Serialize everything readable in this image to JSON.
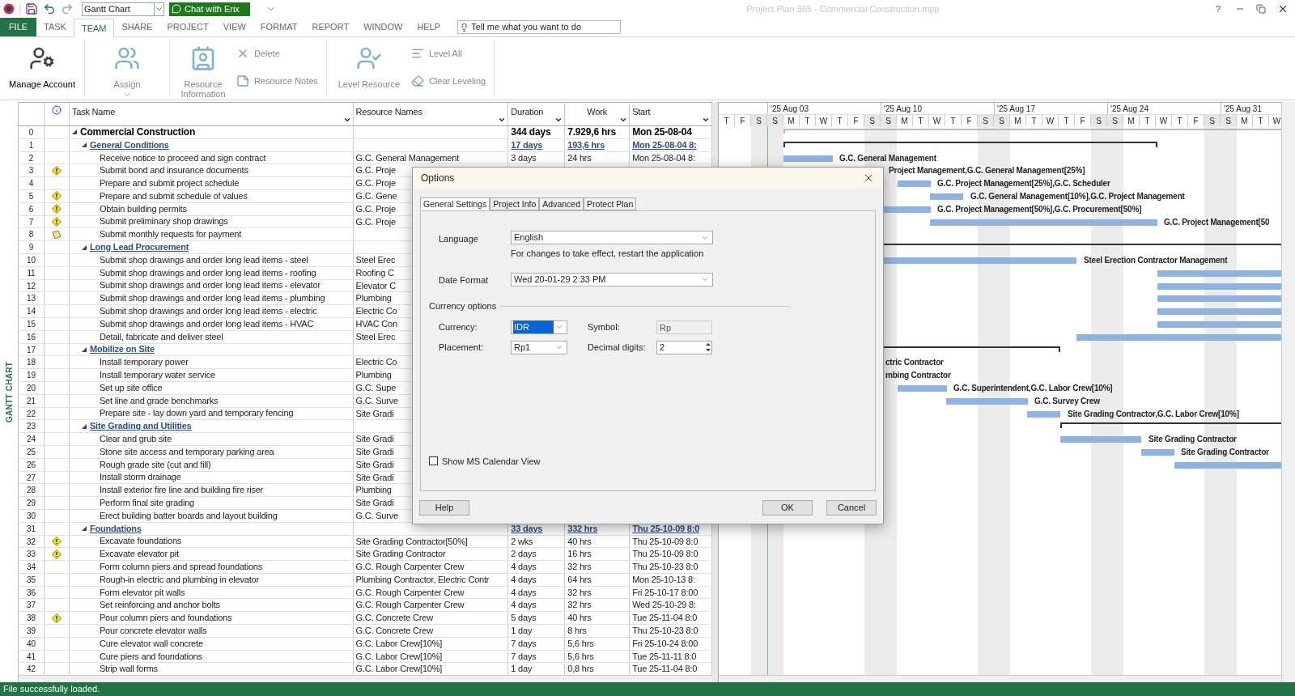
{
  "quick_access": {
    "view_selector": "Gantt Chart",
    "chat_button": "Chat with Erix"
  },
  "window": {
    "title": "Project Plan 365 - Commercial Construction.mpp",
    "help": "?"
  },
  "file_tab": "FILE",
  "ribbon_tabs": [
    {
      "label": "TASK",
      "selected": false
    },
    {
      "label": "TEAM",
      "selected": true
    },
    {
      "label": "SHARE",
      "selected": false
    },
    {
      "label": "PROJECT",
      "selected": false
    },
    {
      "label": "VIEW",
      "selected": false
    },
    {
      "label": "FORMAT",
      "selected": false
    },
    {
      "label": "REPORT",
      "selected": false
    },
    {
      "label": "WINDOW",
      "selected": false
    },
    {
      "label": "HELP",
      "selected": false
    }
  ],
  "tell_me": {
    "placeholder": "Tell me what you want to do"
  },
  "ribbon_groups": [
    {
      "items": [
        {
          "kind": "large",
          "label": "Manage Account",
          "disabled": false
        }
      ]
    },
    {
      "items": [
        {
          "kind": "large",
          "label": "Assign",
          "disabled": true,
          "has_menu": true
        }
      ]
    },
    {
      "items": [
        {
          "kind": "large",
          "label": "Resource Information",
          "disabled": true
        },
        {
          "kind": "small",
          "label": "Delete",
          "disabled": true
        },
        {
          "kind": "small",
          "label": "Resource Notes",
          "disabled": true
        }
      ]
    },
    {
      "items": [
        {
          "kind": "large",
          "label": "Level Resource",
          "disabled": true
        },
        {
          "kind": "small",
          "label": "Level All",
          "disabled": true
        },
        {
          "kind": "small",
          "label": "Clear Leveling",
          "disabled": true
        }
      ]
    }
  ],
  "side_label": "GANTT CHART",
  "table": {
    "columns": [
      "Task Name",
      "Resource Names",
      "Duration",
      "Work",
      "Start"
    ],
    "tasks": [
      {
        "id": "0",
        "name": "Commercial Construction",
        "duration": "344 days",
        "work": "7.929,6 hrs",
        "start": "Mon 25-08-04",
        "expanded": true,
        "children": [
          {
            "id": "1",
            "name": "General Conditions",
            "duration": "17 days",
            "work": "193,6 hrs",
            "start": "Mon 25-08-04 8:",
            "expanded": true,
            "children": [
              {
                "id": "2",
                "name": "Receive notice to proceed and sign contract",
                "resource": "G.C. General Management",
                "duration": "3 days",
                "work": "24 hrs",
                "start": "Mon 25-08-04 8:",
                "bar_label": "G.C. General Management"
              },
              {
                "id": "3",
                "indicator": {
                  "kind": "warning"
                },
                "name": "Submit bond and insurance documents",
                "resource": "G.C. Proje",
                "bar_label": "Project Management,G.C. General Management[25%]"
              },
              {
                "id": "4",
                "name": "Prepare and submit project schedule",
                "resource": "G.C. Proje",
                "bar_label": "G.C. Project Management[25%],G.C. Scheduler"
              },
              {
                "id": "5",
                "indicator": {
                  "kind": "warning"
                },
                "name": "Prepare and submit schedule of values",
                "resource": "G.C. Gene",
                "bar_label": "G.C. General Management[10%],G.C. Project Management"
              },
              {
                "id": "6",
                "indicator": {
                  "kind": "warning"
                },
                "name": "Obtain building permits",
                "resource": "G.C. Proje",
                "bar_label": "G.C. Project Management[50%],G.C. Procurement[50%]"
              },
              {
                "id": "7",
                "indicator": {
                  "kind": "warning"
                },
                "name": "Submit preliminary shop drawings",
                "resource": "G.C. Proje",
                "bar_label": "G.C. Project Management[50"
              },
              {
                "id": "8",
                "indicator": {
                  "kind": "note"
                },
                "name": "Submit monthly requests for payment"
              }
            ]
          },
          {
            "id": "9",
            "name": "Long Lead Procurement",
            "expanded": true,
            "children": [
              {
                "id": "10",
                "name": "Submit shop drawings and order long lead items - steel",
                "resource": "Steel Erec",
                "bar_label": "Steel Erection Contractor Management"
              },
              {
                "id": "11",
                "name": "Submit shop drawings and order long lead items - roofing",
                "resource": "Roofing C"
              },
              {
                "id": "12",
                "name": "Submit shop drawings and order long lead items - elevator",
                "resource": "Elevator C"
              },
              {
                "id": "13",
                "name": "Submit shop drawings and order long lead items - plumbing",
                "resource": "Plumbing"
              },
              {
                "id": "14",
                "name": "Submit shop drawings and order long lead items - electric",
                "resource": "Electric Co"
              },
              {
                "id": "15",
                "name": "Submit shop drawings and order long lead items - HVAC",
                "resource": "HVAC Con"
              },
              {
                "id": "16",
                "name": "Detail, fabricate and deliver steel",
                "resource": "Steel Erec"
              }
            ]
          },
          {
            "id": "17",
            "name": "Mobilize on Site",
            "expanded": true,
            "children": [
              {
                "id": "18",
                "name": "Install temporary power",
                "resource": "Electric Co",
                "bar_label": "ctric Contractor"
              },
              {
                "id": "19",
                "name": "Install temporary water service",
                "resource": "Plumbing",
                "bar_label": "mbing Contractor"
              },
              {
                "id": "20",
                "name": "Set up site office",
                "resource": "G.C. Supe",
                "bar_label": "G.C. Superintendent,G.C. Labor Crew[10%]"
              },
              {
                "id": "21",
                "name": "Set line and grade benchmarks",
                "resource": "G.C. Surve",
                "bar_label": "G.C. Survey Crew"
              },
              {
                "id": "22",
                "name": "Prepare site - lay down yard and temporary fencing",
                "resource": "Site Gradi",
                "bar_label": "Site Grading Contractor,G.C. Labor Crew[10%]"
              }
            ]
          },
          {
            "id": "23",
            "name": "Site Grading and Utilities",
            "expanded": true,
            "children": [
              {
                "id": "24",
                "name": "Clear and grub site",
                "resource": "Site Gradi",
                "bar_label": "Site Grading Contractor"
              },
              {
                "id": "25",
                "name": "Stone site access and temporary parking area",
                "resource": "Site Gradi",
                "bar_label": "Site Grading Contractor"
              },
              {
                "id": "26",
                "name": "Rough grade site (cut and fill)",
                "resource": "Site Gradi"
              },
              {
                "id": "27",
                "name": "Install storm drainage",
                "resource": "Site Gradi"
              },
              {
                "id": "28",
                "name": "Install exterior fire line and building fire riser",
                "resource": "Plumbing"
              },
              {
                "id": "29",
                "name": "Perform final site grading",
                "resource": "Site Gradi"
              },
              {
                "id": "30",
                "name": "Erect building batter boards and layout building",
                "resource": "G.C. Surve"
              }
            ]
          },
          {
            "id": "31",
            "name": "Foundations",
            "duration": "33 days",
            "work": "332 hrs",
            "start": "Thu 25-10-09 8:0",
            "expanded": true,
            "children": [
              {
                "id": "32",
                "indicator": {
                  "kind": "warning"
                },
                "name": "Excavate foundations",
                "resource": "Site Grading Contractor[50%]",
                "duration": "2 wks",
                "work": "40 hrs",
                "start": "Thu 25-10-09 8:0"
              },
              {
                "id": "33",
                "indicator": {
                  "kind": "warning"
                },
                "name": "Excavate elevator pit",
                "resource": "Site Grading Contractor",
                "duration": "2 days",
                "work": "16 hrs",
                "start": "Thu 25-10-09 8:0"
              },
              {
                "id": "34",
                "name": "Form column piers and spread foundations",
                "resource": "G.C. Rough Carpenter Crew",
                "duration": "4 days",
                "work": "32 hrs",
                "start": "Thu 25-10-23 8:0"
              },
              {
                "id": "35",
                "name": "Rough-in electric and plumbing in elevator",
                "resource": "Plumbing Contractor, Electric Contr",
                "duration": "4 days",
                "work": "64 hrs",
                "start": "Mon 25-10-13 8:"
              },
              {
                "id": "36",
                "name": "Form elevator pit walls",
                "resource": "G.C. Rough Carpenter Crew",
                "duration": "4 days",
                "work": "32 hrs",
                "start": "Fri 25-10-17 8:00"
              },
              {
                "id": "37",
                "name": "Set reinforcing and anchor bolts",
                "resource": "G.C. Rough Carpenter Crew",
                "duration": "4 days",
                "work": "32 hrs",
                "start": "Wed 25-10-29 8:"
              },
              {
                "id": "38",
                "indicator": {
                  "kind": "warning"
                },
                "name": "Pour column piers and foundations",
                "resource": "G.C. Concrete Crew",
                "duration": "5 days",
                "work": "40 hrs",
                "start": "Tue 25-11-04 8:0"
              },
              {
                "id": "39",
                "name": "Pour concrete elevator walls",
                "resource": "G.C. Concrete Crew",
                "duration": "1 day",
                "work": "8 hrs",
                "start": "Thu 25-10-23 8:0"
              },
              {
                "id": "40",
                "name": "Cure elevator wall concrete",
                "resource": "G.C. Labor Crew[10%]",
                "duration": "7 days",
                "work": "5,6 hrs",
                "start": "Fri 25-10-24 8:00"
              },
              {
                "id": "41",
                "name": "Cure piers and foundations",
                "resource": "G.C. Labor Crew[10%]",
                "duration": "7 days",
                "work": "5,6 hrs",
                "start": "Tue 25-11-11 8:0"
              },
              {
                "id": "42",
                "name": "Strip wall forms",
                "resource": "G.C. Labor Crew[10%]",
                "duration": "1 day",
                "work": "0,8 hrs",
                "start": "Tue 25-11-04 8:0"
              }
            ]
          }
        ]
      }
    ]
  },
  "timescale": {
    "weeks": [
      "'25 Aug 03",
      "'25 Aug 10",
      "'25 Aug 17",
      "'25 Aug 24",
      "'25 Aug 31"
    ],
    "days": [
      {
        "label": "T",
        "weekend": false
      },
      {
        "label": "F",
        "weekend": false
      },
      {
        "label": "S",
        "weekend": true
      },
      {
        "label": "S",
        "weekend": true
      },
      {
        "label": "M",
        "weekend": false
      },
      {
        "label": "T",
        "weekend": false
      },
      {
        "label": "W",
        "weekend": false
      },
      {
        "label": "T",
        "weekend": false
      },
      {
        "label": "F",
        "weekend": false
      },
      {
        "label": "S",
        "weekend": true
      },
      {
        "label": "S",
        "weekend": true
      },
      {
        "label": "M",
        "weekend": false
      },
      {
        "label": "T",
        "weekend": false
      },
      {
        "label": "W",
        "weekend": false
      },
      {
        "label": "T",
        "weekend": false
      },
      {
        "label": "F",
        "weekend": false
      },
      {
        "label": "S",
        "weekend": true
      },
      {
        "label": "S",
        "weekend": true
      },
      {
        "label": "M",
        "weekend": false
      },
      {
        "label": "T",
        "weekend": false
      },
      {
        "label": "W",
        "weekend": false
      },
      {
        "label": "T",
        "weekend": false
      },
      {
        "label": "F",
        "weekend": false
      },
      {
        "label": "S",
        "weekend": true
      },
      {
        "label": "S",
        "weekend": true
      },
      {
        "label": "M",
        "weekend": false
      },
      {
        "label": "T",
        "weekend": false
      },
      {
        "label": "W",
        "weekend": false
      },
      {
        "label": "T",
        "weekend": false
      },
      {
        "label": "F",
        "weekend": false
      },
      {
        "label": "S",
        "weekend": true
      },
      {
        "label": "S",
        "weekend": true
      },
      {
        "label": "M",
        "weekend": false
      },
      {
        "label": "T",
        "weekend": false
      },
      {
        "label": "W",
        "weekend": false
      }
    ]
  },
  "dialog": {
    "title": "Options",
    "tabs": [
      {
        "label": "General Settings",
        "selected": true
      },
      {
        "label": "Project Info",
        "selected": false
      },
      {
        "label": "Advanced",
        "selected": false
      },
      {
        "label": "Protect Plan",
        "selected": false
      }
    ],
    "language": {
      "label": "Language",
      "value": "English",
      "hint": "For changes to take effect, restart the application"
    },
    "date_format": {
      "label": "Date Format",
      "value": "Wed 20-01-29 2:33 PM"
    },
    "currency_group": "Currency options",
    "currency": {
      "label": "Currency:",
      "value": "IDR"
    },
    "symbol": {
      "label": "Symbol:",
      "value": "Rp",
      "disabled": true
    },
    "placement": {
      "label": "Placement:",
      "value": "Rp1"
    },
    "decimal_digits": {
      "label": "Decimal digits:",
      "value": "2"
    },
    "calendar_view": {
      "label": "Show MS Calendar View",
      "checked": false
    },
    "buttons": [
      "Help",
      "OK",
      "Cancel"
    ]
  },
  "status_bar": "File successfully loaded."
}
